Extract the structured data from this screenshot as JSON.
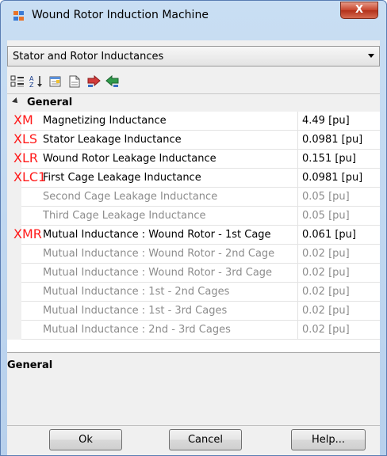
{
  "window": {
    "title": "Wound Rotor Induction Machine",
    "close_label": "X"
  },
  "combo": {
    "selected": "Stator and Rotor Inductances"
  },
  "toolbar": {
    "icons": [
      "categorized-icon",
      "alphabetical-icon",
      "property-pages-icon",
      "new-page-icon",
      "import-icon",
      "export-icon"
    ]
  },
  "grid": {
    "category": "General",
    "rows": [
      {
        "tag": "XM",
        "name": "Magnetizing Inductance",
        "value": "4.49 [pu]",
        "enabled": true
      },
      {
        "tag": "XLS",
        "name": "Stator Leakage Inductance",
        "value": "0.0981 [pu]",
        "enabled": true
      },
      {
        "tag": "XLR",
        "name": "Wound Rotor Leakage Inductance",
        "value": "0.151 [pu]",
        "enabled": true
      },
      {
        "tag": "XLC1",
        "name": "First Cage Leakage Inductance",
        "value": "0.0981 [pu]",
        "enabled": true
      },
      {
        "tag": "",
        "name": "Second Cage Leakage Inductance",
        "value": "0.05 [pu]",
        "enabled": false
      },
      {
        "tag": "",
        "name": "Third Cage Leakage Inductance",
        "value": "0.05 [pu]",
        "enabled": false
      },
      {
        "tag": "XMR",
        "name": "Mutual Inductance : Wound Rotor - 1st Cage",
        "value": "0.061 [pu]",
        "enabled": true
      },
      {
        "tag": "",
        "name": "Mutual Inductance : Wound Rotor - 2nd Cage",
        "value": "0.02 [pu]",
        "enabled": false
      },
      {
        "tag": "",
        "name": "Mutual Inductance : Wound Rotor - 3rd Cage",
        "value": "0.02 [pu]",
        "enabled": false
      },
      {
        "tag": "",
        "name": "Mutual Inductance : 1st - 2nd Cages",
        "value": "0.02 [pu]",
        "enabled": false
      },
      {
        "tag": "",
        "name": "Mutual Inductance : 1st - 3rd Cages",
        "value": "0.02 [pu]",
        "enabled": false
      },
      {
        "tag": "",
        "name": "Mutual Inductance : 2nd - 3rd Cages",
        "value": "0.02 [pu]",
        "enabled": false
      }
    ]
  },
  "description": {
    "title": "General"
  },
  "buttons": {
    "ok": "Ok",
    "cancel": "Cancel",
    "help": "Help..."
  }
}
